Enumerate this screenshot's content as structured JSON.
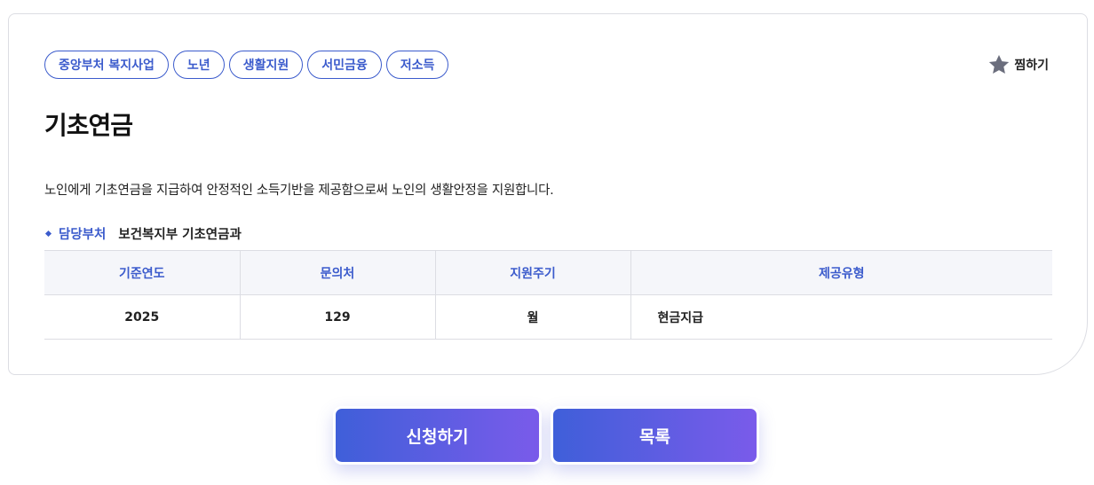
{
  "tags": [
    "중앙부처 복지사업",
    "노년",
    "생활지원",
    "서민금융",
    "저소득"
  ],
  "bookmark": {
    "icon": "star-icon",
    "label": "찜하기"
  },
  "title": "기초연금",
  "description": "노인에게 기초연금을 지급하여 안정적인 소득기반을 제공함으로써 노인의 생활안정을 지원합니다.",
  "department": {
    "label": "담당부처",
    "value": "보건복지부 기초연금과"
  },
  "table": {
    "headers": [
      "기준연도",
      "문의처",
      "지원주기",
      "제공유형"
    ],
    "row": [
      "2025",
      "129",
      "월",
      "현금지급"
    ]
  },
  "buttons": {
    "apply": "신청하기",
    "list": "목록"
  },
  "colors": {
    "accent": "#3b5bcc",
    "button_start": "#3f5fd9",
    "button_end": "#7a5bea"
  }
}
